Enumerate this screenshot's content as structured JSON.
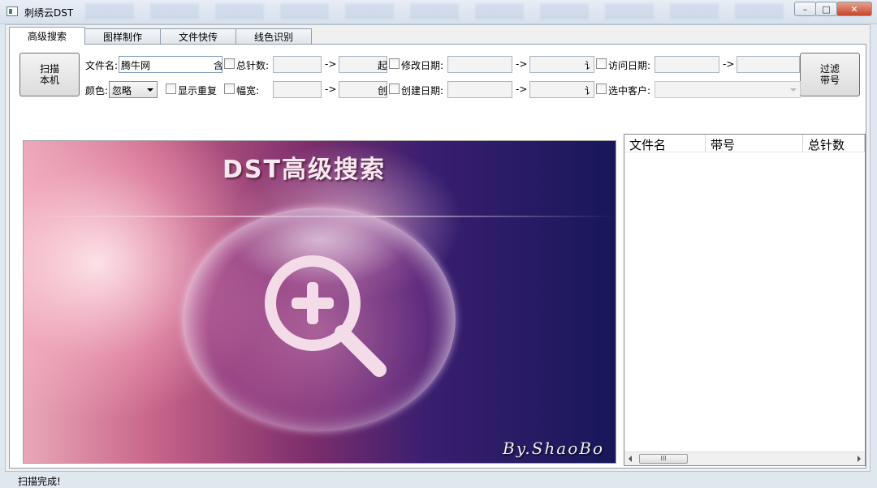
{
  "window": {
    "title": "刺绣云DST",
    "controls": {
      "minimize": "–",
      "maximize": "□",
      "close": "✕"
    }
  },
  "tabs": [
    {
      "label": "高级搜索",
      "active": true
    },
    {
      "label": "图样制作",
      "active": false
    },
    {
      "label": "文件快传",
      "active": false
    },
    {
      "label": "线色识别",
      "active": false
    }
  ],
  "search": {
    "scan_button": "扫描\n本机",
    "filter_button": "过滤\n带号",
    "filename_label": "文件名:",
    "filename_value": "腾牛网",
    "filename_suffix": "含",
    "total_stitches_label": "总针数:",
    "total_suffix": "起",
    "modify_date_label": "修改日期:",
    "modify_suffix": "讠",
    "access_date_label": "访问日期:",
    "color_label": "颜色:",
    "color_value": "忽略",
    "show_dup_label": "显示重复",
    "width_label": "幅宽:",
    "width_suffix": "创",
    "create_date_label": "创建日期:",
    "create_suffix": "讠",
    "select_customer_label": "选中客户:",
    "arrow": "->"
  },
  "banner": {
    "title": "DST高级搜索",
    "signature": "By.ShaoBo"
  },
  "list": {
    "columns": [
      "文件名",
      "带号",
      "总针数"
    ],
    "scroll_thumb": "III"
  },
  "status": "扫描完成!",
  "colors": {
    "accent": "#7f9db9",
    "close_button": "#c8452c"
  }
}
